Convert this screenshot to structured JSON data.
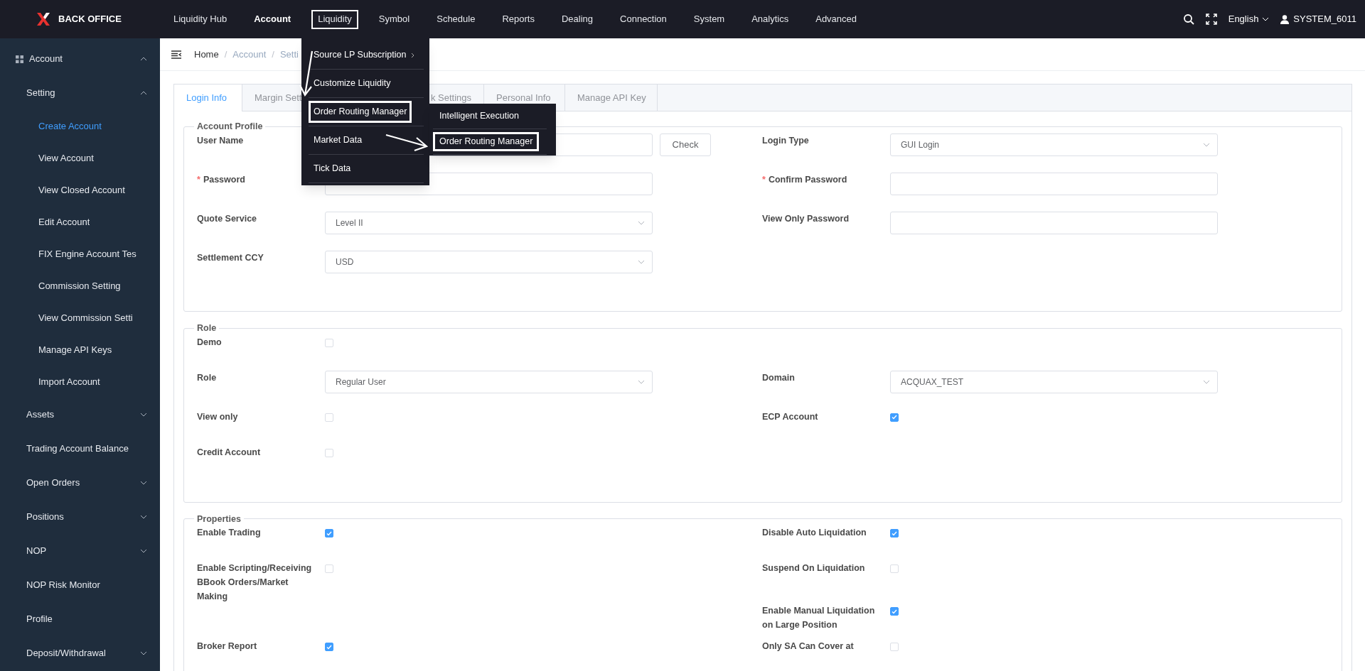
{
  "topbar": {
    "brand": "BACK OFFICE",
    "nav": [
      {
        "label": "Liquidity Hub",
        "selected": false,
        "highlighted": false
      },
      {
        "label": "Account",
        "selected": true,
        "highlighted": false
      },
      {
        "label": "Liquidity",
        "selected": false,
        "highlighted": true
      },
      {
        "label": "Symbol",
        "selected": false,
        "highlighted": false
      },
      {
        "label": "Schedule",
        "selected": false,
        "highlighted": false
      },
      {
        "label": "Reports",
        "selected": false,
        "highlighted": false
      },
      {
        "label": "Dealing",
        "selected": false,
        "highlighted": false
      },
      {
        "label": "Connection",
        "selected": false,
        "highlighted": false
      },
      {
        "label": "System",
        "selected": false,
        "highlighted": false
      },
      {
        "label": "Analytics",
        "selected": false,
        "highlighted": false
      },
      {
        "label": "Advanced",
        "selected": false,
        "highlighted": false
      }
    ],
    "language": "English",
    "user": "SYSTEM_6011"
  },
  "sidebar": {
    "items": [
      {
        "label": "Account",
        "kind": "group",
        "expanded": true,
        "children": [
          {
            "label": "Setting",
            "kind": "group",
            "expanded": true,
            "children": [
              {
                "label": "Create Account",
                "kind": "link",
                "selected": true
              },
              {
                "label": "View Account",
                "kind": "link",
                "selected": false
              },
              {
                "label": "View Closed Account",
                "kind": "link",
                "selected": false
              },
              {
                "label": "Edit Account",
                "kind": "link",
                "selected": false
              },
              {
                "label": "FIX Engine Account Tes",
                "kind": "link",
                "selected": false
              },
              {
                "label": "Commission Setting",
                "kind": "link",
                "selected": false
              },
              {
                "label": "View Commission Setti",
                "kind": "link",
                "selected": false
              },
              {
                "label": "Manage API Keys",
                "kind": "link",
                "selected": false
              },
              {
                "label": "Import Account",
                "kind": "link",
                "selected": false
              }
            ]
          },
          {
            "label": "Assets",
            "kind": "group",
            "expanded": false
          },
          {
            "label": "Trading Account Balance",
            "kind": "link",
            "selected": false
          },
          {
            "label": "Open Orders",
            "kind": "group",
            "expanded": false
          },
          {
            "label": "Positions",
            "kind": "group",
            "expanded": false
          },
          {
            "label": "NOP",
            "kind": "group",
            "expanded": false
          },
          {
            "label": "NOP Risk Monitor",
            "kind": "link",
            "selected": false
          },
          {
            "label": "Profile",
            "kind": "link",
            "selected": false
          },
          {
            "label": "Deposit/Withdrawal",
            "kind": "group",
            "expanded": false
          }
        ]
      }
    ]
  },
  "breadcrumb": [
    {
      "label": "Home"
    },
    {
      "separator": "/",
      "label": "Account"
    },
    {
      "separator": "/",
      "label": "Setti"
    }
  ],
  "liquidity_menu": {
    "items": [
      {
        "label": "Source LP Subscription",
        "has_submenu": true,
        "highlighted": false
      },
      {
        "label": "Customize Liquidity",
        "has_submenu": false,
        "highlighted": false
      },
      {
        "label": "Order Routing Manager",
        "has_submenu": false,
        "highlighted": true
      },
      {
        "label": "Market Data",
        "has_submenu": false,
        "highlighted": false
      },
      {
        "label": "Tick Data",
        "has_submenu": false,
        "highlighted": false
      }
    ],
    "submenu": [
      {
        "label": "Intelligent Execution",
        "highlighted": false
      },
      {
        "label": "Order Routing Manager",
        "highlighted": true
      }
    ]
  },
  "tabs": [
    {
      "label": "Login Info",
      "selected": true
    },
    {
      "label": "Margin Sett",
      "selected": false
    },
    {
      "label": "k Settings",
      "selected": false
    },
    {
      "label": "Personal Info",
      "selected": false
    },
    {
      "label": "Manage API Key",
      "selected": false
    }
  ],
  "sections": [
    {
      "title": "Account Profile",
      "rows": [
        {
          "left": {
            "label": "User Name",
            "kind": "text",
            "button": "Check"
          },
          "right": {
            "label": "Login Type",
            "kind": "select",
            "value": "GUI Login"
          }
        },
        {
          "left": {
            "label": "Password",
            "kind": "text",
            "required_mark": "*"
          },
          "right": {
            "label": "Confirm Password",
            "kind": "text",
            "required_mark": "*"
          }
        },
        {
          "left": {
            "label": "Quote Service",
            "kind": "select",
            "value": "Level II"
          },
          "right": {
            "label": "View Only Password",
            "kind": "text"
          }
        },
        {
          "left": {
            "label": "Settlement CCY",
            "kind": "select",
            "value": "USD"
          }
        }
      ]
    },
    {
      "title": "Role",
      "rows": [
        {
          "left": {
            "label": "Demo",
            "kind": "checkbox",
            "checked": false
          }
        },
        {
          "left": {
            "label": "Role",
            "kind": "select",
            "value": "Regular User"
          },
          "right": {
            "label": "Domain",
            "kind": "select",
            "value": "ACQUAX_TEST"
          }
        },
        {
          "left": {
            "label": "View only",
            "kind": "checkbox",
            "checked": false
          },
          "right": {
            "label": "ECP Account",
            "kind": "checkbox",
            "checked": true
          }
        },
        {
          "left": {
            "label": "Credit Account",
            "kind": "checkbox",
            "checked": false
          }
        }
      ]
    },
    {
      "title": "Properties",
      "rows": [
        {
          "left": {
            "label": "Enable Trading",
            "kind": "checkbox",
            "checked": true
          },
          "right": {
            "label": "Disable Auto Liquidation",
            "kind": "checkbox",
            "checked": true
          }
        },
        {
          "left": {
            "label": "Enable Scripting/Receiving BBook Orders/Market Making",
            "kind": "checkbox",
            "checked": false
          },
          "right": {
            "label": "Suspend On Liquidation",
            "kind": "checkbox",
            "checked": false
          }
        },
        {
          "right": {
            "label": "Enable Manual Liquidation on Large Position",
            "kind": "checkbox",
            "checked": true
          }
        },
        {
          "left": {
            "label": "Broker Report",
            "kind": "checkbox",
            "checked": true
          },
          "right": {
            "label": "Only SA Can Cover at",
            "kind": "checkbox",
            "checked": false
          }
        }
      ]
    }
  ]
}
